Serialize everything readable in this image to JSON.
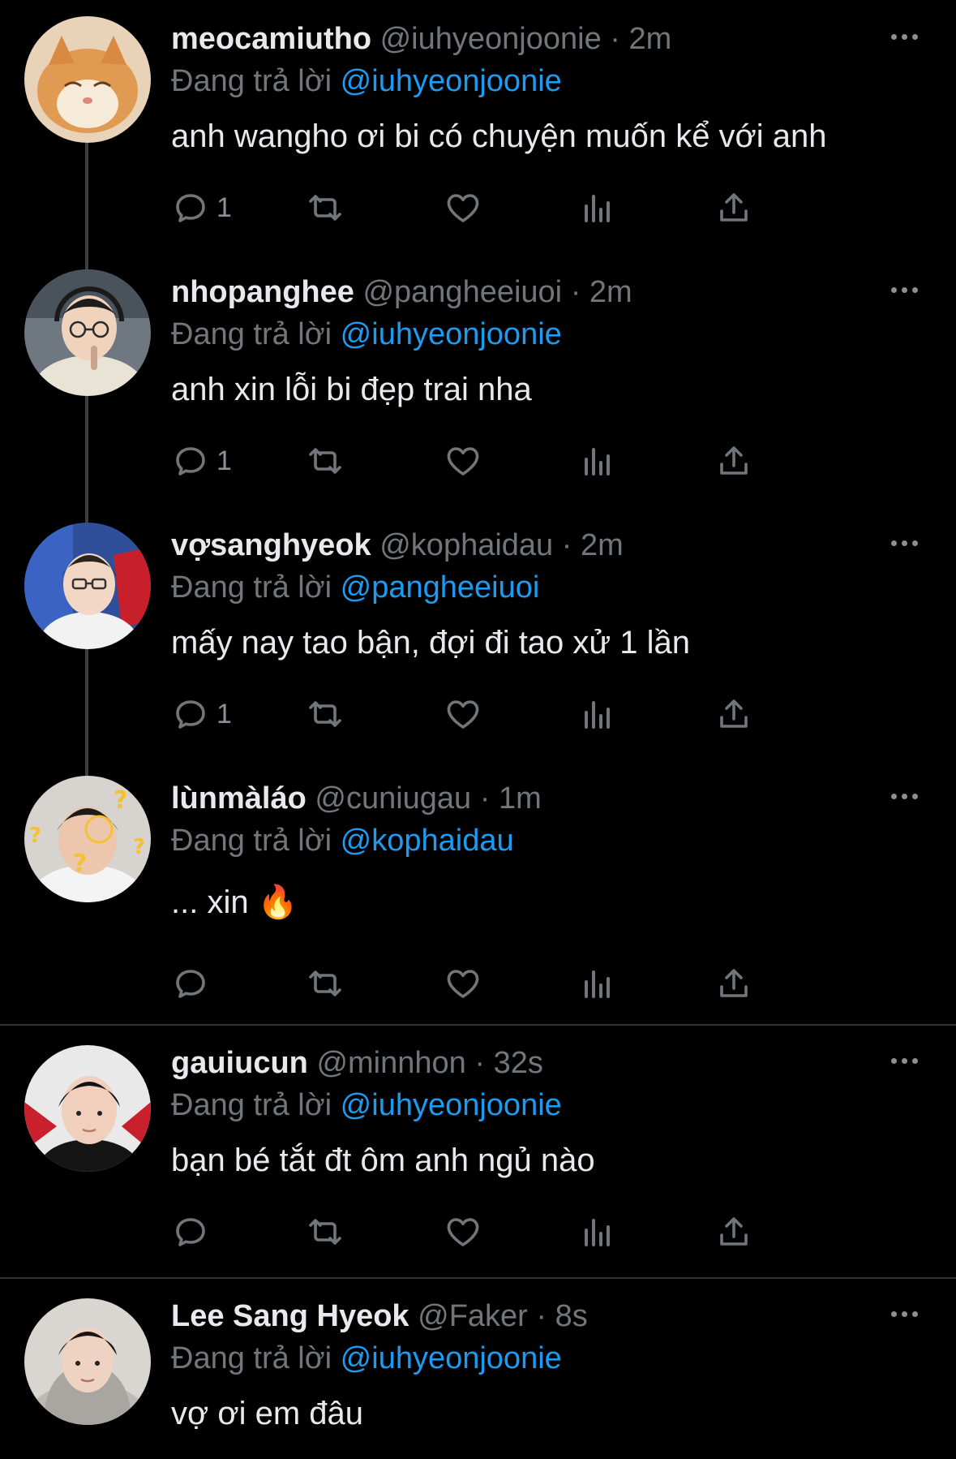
{
  "reply_prefix": "Đang trả lời",
  "tweets": [
    {
      "name": "meocamiutho",
      "handle": "@iuhyeonjoonie",
      "time": "2m",
      "reply_to": "@iuhyeonjoonie",
      "text": "anh wangho ơi bi có chuyện muốn kể với anh",
      "reply_count": "1",
      "avatar": "orange-cat"
    },
    {
      "name": "nhopanghee",
      "handle": "@pangheeiuoi",
      "time": "2m",
      "reply_to": "@iuhyeonjoonie",
      "text": "anh xin lỗi bi đẹp trai nha",
      "reply_count": "1",
      "avatar": "man-glasses-headset"
    },
    {
      "name": "vợsanghyeok",
      "handle": "@kophaidau",
      "time": "2m",
      "reply_to": "@pangheeiuoi",
      "text": "mấy nay tao bận, đợi đi tao xử 1 lần",
      "reply_count": "1",
      "avatar": "man-glasses-red-chair"
    },
    {
      "name": "lùnmàláo",
      "handle": "@cuniugau",
      "time": "1m",
      "reply_to": "@kophaidau",
      "text": "... xin 🔥",
      "reply_count": "",
      "avatar": "man-question-marks"
    },
    {
      "name": "gauiucun",
      "handle": "@minnhon",
      "time": "32s",
      "reply_to": "@iuhyeonjoonie",
      "text": "bạn bé tắt đt ôm anh ngủ nào",
      "reply_count": "",
      "avatar": "young-man-red-chair"
    },
    {
      "name": "Lee Sang Hyeok",
      "handle": "@Faker",
      "time": "8s",
      "reply_to": "@iuhyeonjoonie",
      "text": "vợ ơi em đâu",
      "reply_count": "",
      "avatar": "man-grey-hoodie"
    }
  ],
  "colors": {
    "background": "#000000",
    "text": "#e7e9ea",
    "muted": "#71767b",
    "link": "#1d9bf0"
  }
}
